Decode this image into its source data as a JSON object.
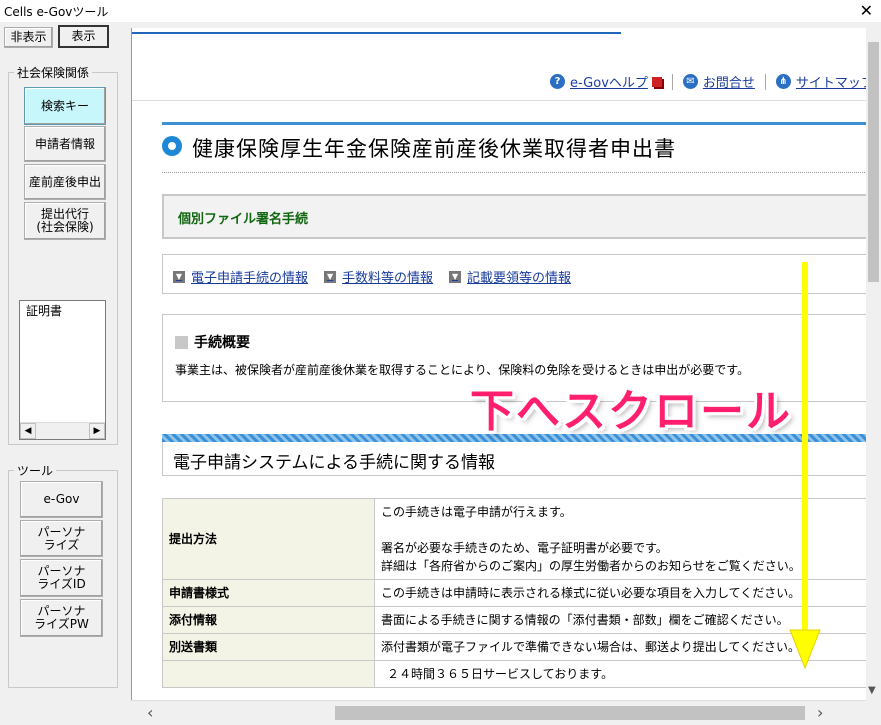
{
  "window": {
    "title": "Cells e-Govツール",
    "close_glyph": "✕"
  },
  "toolbar": {
    "hide_label": "非表示",
    "show_label": "表示"
  },
  "social_group": {
    "label": "社会保険関係",
    "buttons": [
      {
        "label": "検索キー"
      },
      {
        "label": "申請者情報"
      },
      {
        "label": "産前産後申出"
      },
      {
        "label": "提出代行\n(社会保険)"
      }
    ],
    "list_items": [
      "証明書"
    ]
  },
  "tools_group": {
    "label": "ツール",
    "buttons": [
      {
        "label": "e-Gov"
      },
      {
        "label": "パーソナ\nライズ"
      },
      {
        "label": "パーソナ\nライズID"
      },
      {
        "label": "パーソナ\nライズPW"
      }
    ]
  },
  "header": {
    "links": [
      {
        "label": "e-Govヘルプ",
        "icon": "help-icon"
      },
      {
        "label": "お問合せ",
        "icon": "mail-icon"
      },
      {
        "label": "サイトマップ",
        "icon": "sitemap-icon"
      }
    ]
  },
  "page": {
    "title": "健康保険厚生年金保険産前産後休業取得者申出書",
    "sign_section": "個別ファイル署名手続",
    "info_links": [
      "電子申請手続の情報",
      "手数料等の情報",
      "記載要領等の情報"
    ],
    "summary": {
      "heading": "手続概要",
      "body": "事業主は、被保険者が産前産後休業を取得することにより、保険料の免除を受けるときは申出が必要です。"
    },
    "section_title": "電子申請システムによる手続に関する情報",
    "table": [
      {
        "header": "提出方法",
        "lines": [
          "この手続きは電子申請が行えます。",
          "",
          "署名が必要な手続きのため、電子証明書が必要です。",
          "詳細は「各府省からのご案内」の厚生労働者からのお知らせをご覧ください。"
        ]
      },
      {
        "header": "申請書様式",
        "lines": [
          "この手続きは申請時に表示される様式に従い必要な項目を入力してください。"
        ]
      },
      {
        "header": "添付情報",
        "lines": [
          "書面による手続きに関する情報の「添付書類・部数」欄をご確認ください。"
        ]
      },
      {
        "header": "別送書類",
        "lines": [
          "添付書類が電子ファイルで準備できない場合は、郵送より提出してください。"
        ]
      },
      {
        "header": "",
        "lines": [
          "２４時間３６５日サービスしております。"
        ]
      }
    ]
  },
  "annotation": {
    "text": "下へスクロール",
    "color": "#ff1f6e",
    "arrow_color": "#ffff00"
  }
}
